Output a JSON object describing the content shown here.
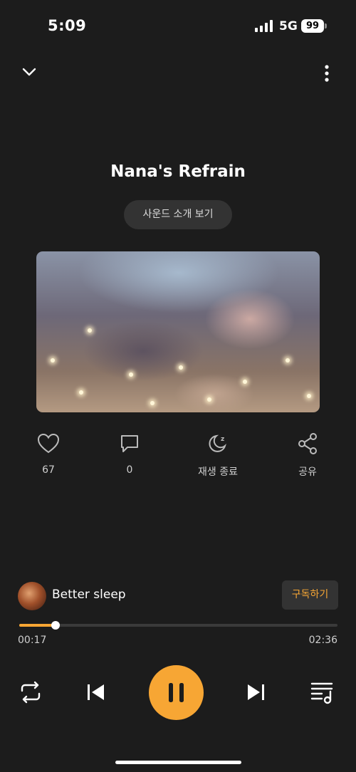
{
  "status_bar": {
    "time": "5:09",
    "network": "5G",
    "battery": "99"
  },
  "header": {
    "title": "Nana's Refrain",
    "intro_button": "사운드 소개 보기"
  },
  "actions": {
    "like_count": "67",
    "comment_count": "0",
    "sleep_timer_label": "재생 종료",
    "share_label": "공유"
  },
  "channel": {
    "name": "Better sleep",
    "subscribe_label": "구독하기"
  },
  "player": {
    "current_time": "00:17",
    "duration": "02:36",
    "progress": 0.115
  },
  "colors": {
    "accent": "#f7a634",
    "background": "#1c1c1c",
    "button_bg": "#333333"
  }
}
